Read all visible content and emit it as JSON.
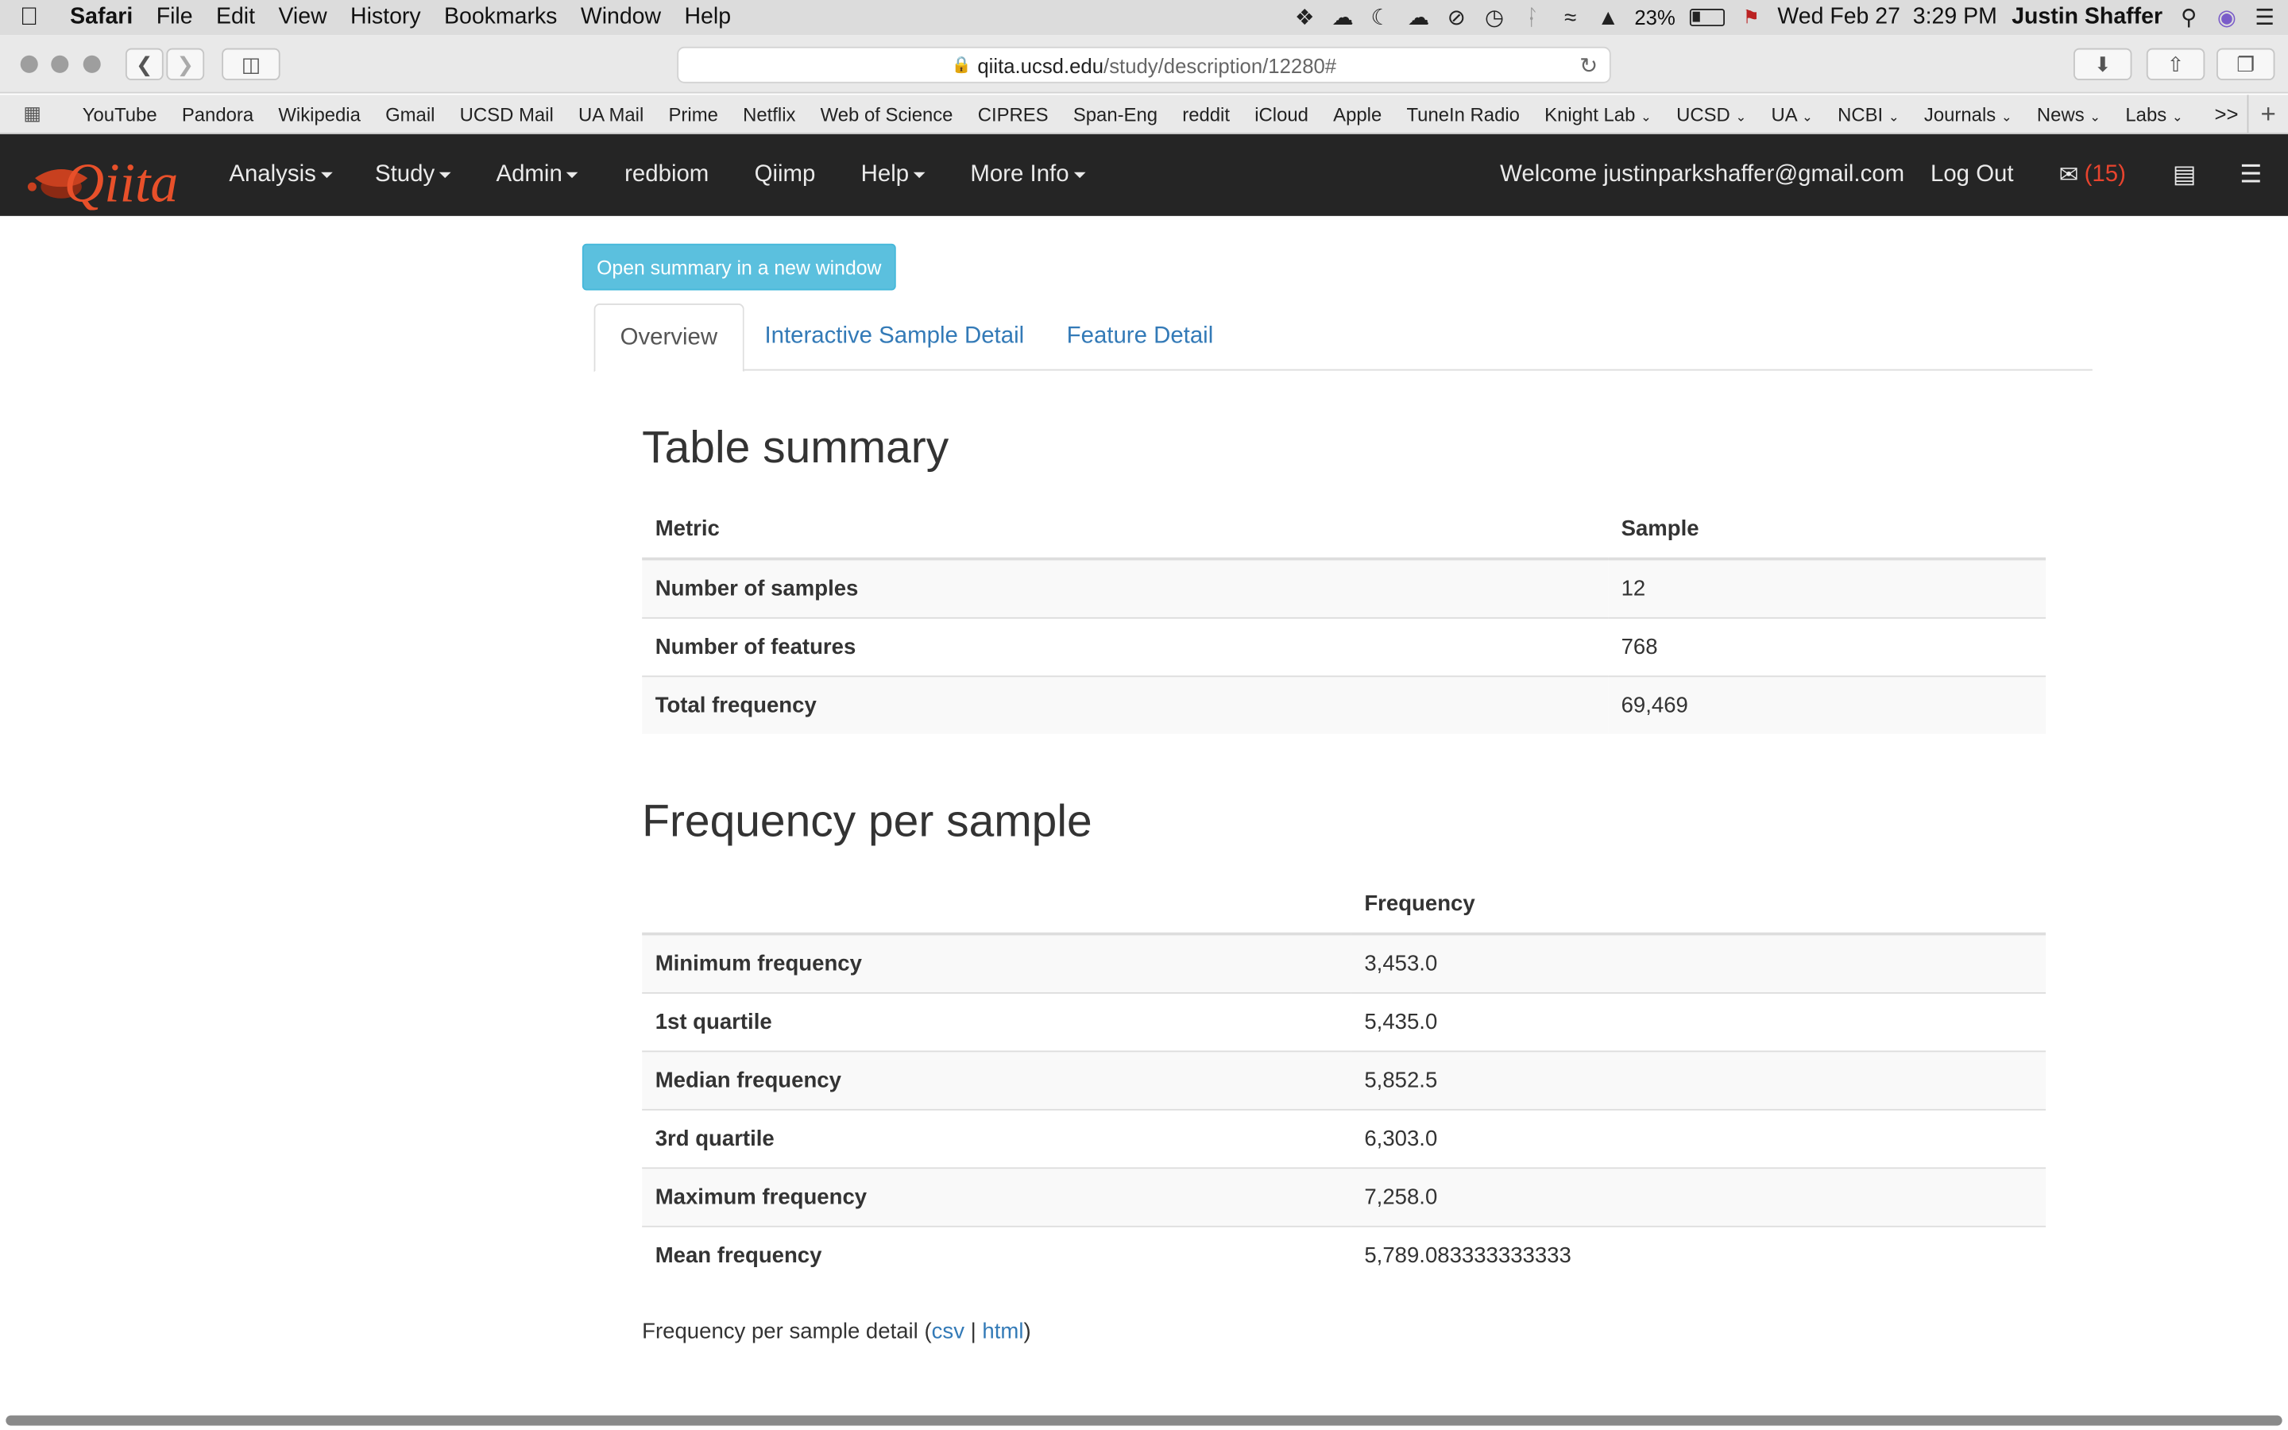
{
  "menubar": {
    "app": "Safari",
    "items": [
      "File",
      "Edit",
      "View",
      "History",
      "Bookmarks",
      "Window",
      "Help"
    ],
    "battery": "23%",
    "datetime": "Wed Feb 27  3:29 PM",
    "user": "Justin Shaffer"
  },
  "browser": {
    "url_domain": "qiita.ucsd.edu",
    "url_path": "/study/description/12280#",
    "bookmarks": [
      "YouTube",
      "Pandora",
      "Wikipedia",
      "Gmail",
      "UCSD Mail",
      "UA Mail",
      "Prime",
      "Netflix",
      "Web of Science",
      "CIPRES",
      "Span-Eng",
      "reddit",
      "iCloud",
      "Apple",
      "TuneIn Radio",
      "Knight Lab",
      "UCSD",
      "UA",
      "NCBI",
      "Journals",
      "News",
      "Labs"
    ],
    "more_label": ">>"
  },
  "qiita_nav": {
    "logo_text": "Qiita",
    "analysis": "Analysis",
    "study": "Study",
    "admin": "Admin",
    "redbiom": "redbiom",
    "qiimp": "Qiimp",
    "help": "Help",
    "more_info": "More Info",
    "welcome": "Welcome justinparkshaffer@gmail.com",
    "logout": "Log Out",
    "mail_count": "(15)"
  },
  "summary_button": "Open summary in a new window",
  "tabs": {
    "overview": "Overview",
    "sample_detail": "Interactive Sample Detail",
    "feature_detail": "Feature Detail"
  },
  "table_summary": {
    "title": "Table summary",
    "headers": [
      "Metric",
      "Sample"
    ],
    "rows": [
      [
        "Number of samples",
        "12"
      ],
      [
        "Number of features",
        "768"
      ],
      [
        "Total frequency",
        "69,469"
      ]
    ]
  },
  "frequency_per_sample": {
    "title": "Frequency per sample",
    "headers": [
      "",
      "Frequency"
    ],
    "rows": [
      [
        "Minimum frequency",
        "3,453.0"
      ],
      [
        "1st quartile",
        "5,435.0"
      ],
      [
        "Median frequency",
        "5,852.5"
      ],
      [
        "3rd quartile",
        "6,303.0"
      ],
      [
        "Maximum frequency",
        "7,258.0"
      ],
      [
        "Mean frequency",
        "5,789.083333333333"
      ]
    ]
  },
  "detail_line": {
    "prefix": "Frequency per sample detail (",
    "csv": "csv",
    "sep": " | ",
    "html": "html",
    "suffix": ")"
  }
}
